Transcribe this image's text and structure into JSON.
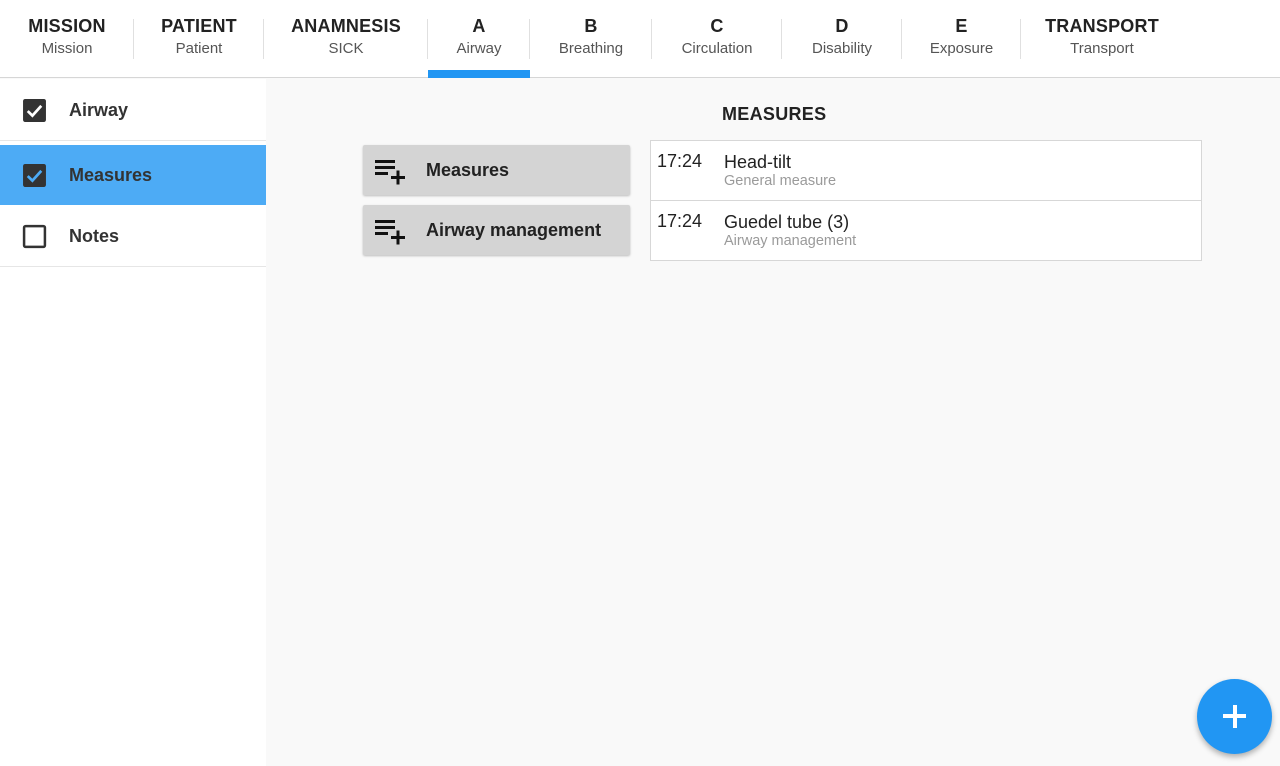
{
  "tabs": [
    {
      "title": "MISSION",
      "subtitle": "Mission",
      "active": false
    },
    {
      "title": "PATIENT",
      "subtitle": "Patient",
      "active": false
    },
    {
      "title": "ANAMNESIS",
      "subtitle": "SICK",
      "active": false
    },
    {
      "title": "A",
      "subtitle": "Airway",
      "active": true
    },
    {
      "title": "B",
      "subtitle": "Breathing",
      "active": false
    },
    {
      "title": "C",
      "subtitle": "Circulation",
      "active": false
    },
    {
      "title": "D",
      "subtitle": "Disability",
      "active": false
    },
    {
      "title": "E",
      "subtitle": "Exposure",
      "active": false
    },
    {
      "title": "TRANSPORT",
      "subtitle": "Transport",
      "active": false
    }
  ],
  "sidebar": {
    "items": [
      {
        "label": "Airway",
        "checked": true,
        "active": false
      },
      {
        "label": "Measures",
        "checked": true,
        "active": true
      },
      {
        "label": "Notes",
        "checked": false,
        "active": false
      }
    ]
  },
  "main": {
    "section_title": "MEASURES",
    "buttons": [
      {
        "label": "Measures",
        "icon": "playlist-add-icon"
      },
      {
        "label": "Airway management",
        "icon": "playlist-add-icon"
      }
    ],
    "entries": [
      {
        "time": "17:24",
        "title": "Head-tilt",
        "subtitle": "General measure"
      },
      {
        "time": "17:24",
        "title": "Guedel tube (3)",
        "subtitle": "Airway management"
      }
    ]
  },
  "fab": {
    "icon": "add-icon"
  },
  "colors": {
    "accent": "#2196f3",
    "active_sidebar": "#4dabf5",
    "button_bg": "#d4d4d4"
  }
}
